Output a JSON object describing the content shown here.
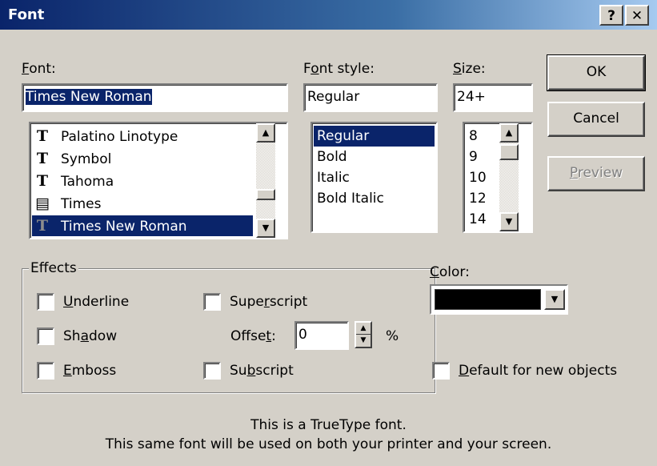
{
  "dialog": {
    "title": "Font",
    "help_button": "?",
    "close_button": "✕"
  },
  "font": {
    "label_pre": "",
    "label_key": "F",
    "label_post": "ont:",
    "value": "Times New Roman",
    "items": [
      {
        "name": "Palatino Linotype",
        "icon": "truetype-icon"
      },
      {
        "name": "Symbol",
        "icon": "truetype-icon"
      },
      {
        "name": "Tahoma",
        "icon": "truetype-icon"
      },
      {
        "name": "Times",
        "icon": "printer-font-icon"
      },
      {
        "name": "Times New Roman",
        "icon": "truetype-icon",
        "selected": true
      }
    ]
  },
  "style": {
    "label_pre": "F",
    "label_key": "o",
    "label_post": "nt style:",
    "value": "Regular",
    "items": [
      "Regular",
      "Bold",
      "Italic",
      "Bold Italic"
    ],
    "selected": "Regular"
  },
  "size": {
    "label_pre": "",
    "label_key": "S",
    "label_post": "ize:",
    "value": "24+",
    "items": [
      "8",
      "9",
      "10",
      "12",
      "14"
    ]
  },
  "buttons": {
    "ok": "OK",
    "cancel": "Cancel",
    "preview_key": "P",
    "preview_rest": "review"
  },
  "effects": {
    "title": "Effects",
    "underline_key": "U",
    "underline_rest": "nderline",
    "shadow_pre": "Sh",
    "shadow_key": "a",
    "shadow_post": "dow",
    "emboss_key": "E",
    "emboss_rest": "mboss",
    "superscript_pre": "Supe",
    "superscript_key": "r",
    "superscript_post": "script",
    "offset_pre": "Offse",
    "offset_key": "t",
    "offset_post": ":",
    "offset_value": "0",
    "offset_unit": "%",
    "subscript_pre": "Su",
    "subscript_key": "b",
    "subscript_post": "script"
  },
  "color": {
    "label_key": "C",
    "label_rest": "olor:",
    "value": "#000000"
  },
  "default": {
    "label_key": "D",
    "label_rest": "efault for new objects"
  },
  "info": {
    "line1": "This is a TrueType font.",
    "line2": "This same font will be used on both your printer and your screen."
  }
}
